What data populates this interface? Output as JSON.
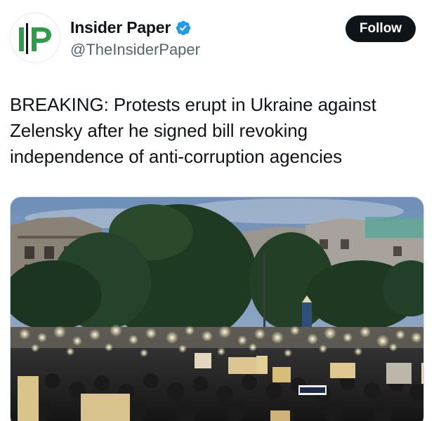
{
  "account": {
    "display_name": "Insider Paper",
    "handle": "@TheInsiderPaper",
    "avatar_text": "IP",
    "verified": true
  },
  "follow_label": "Follow",
  "tweet": {
    "text": "BREAKING: Protests erupt in Ukraine against Zelensky after he signed bill revoking independence of anti-corruption agencies"
  },
  "media": {
    "type": "photo",
    "subject": "crowd-at-dusk-with-phone-lights-and-signs"
  },
  "colors": {
    "text": "#0f1419",
    "secondary_text": "#536471",
    "verified": "#1d9bf0",
    "logo_green": "#2e9d47",
    "follow_bg": "#0f1419"
  }
}
